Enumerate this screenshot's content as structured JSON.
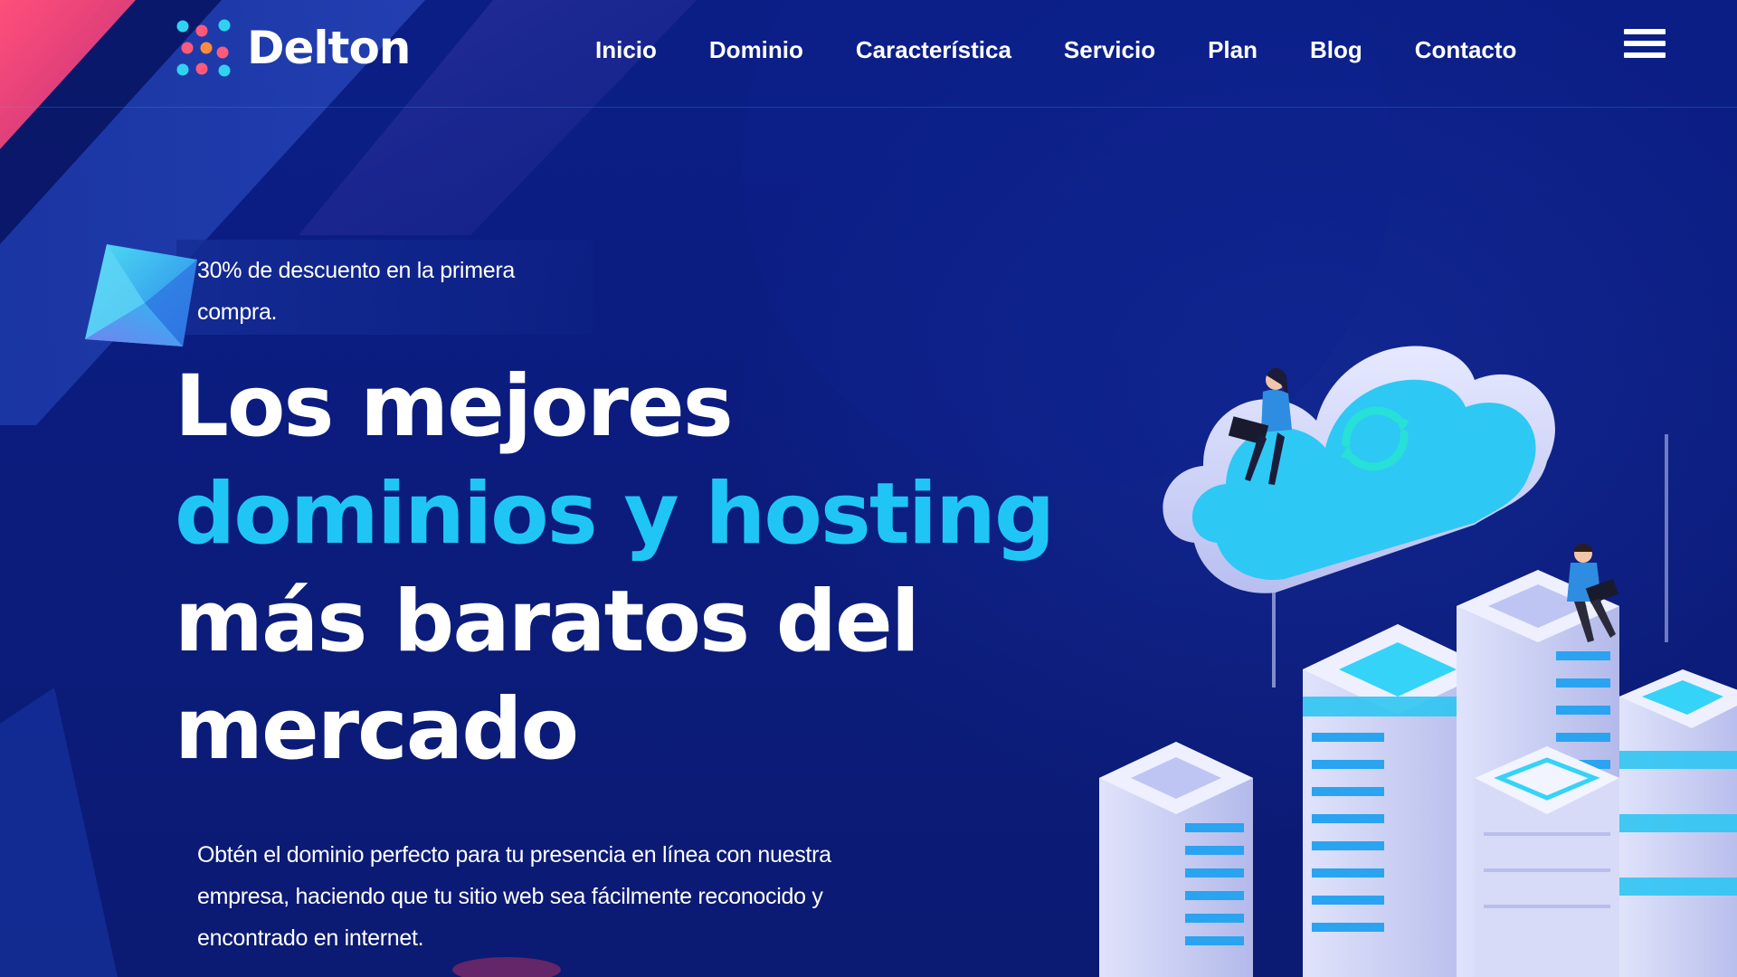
{
  "brand": {
    "name": "Delton"
  },
  "nav": {
    "items": [
      "Inicio",
      "Dominio",
      "Característica",
      "Servicio",
      "Plan",
      "Blog",
      "Contacto"
    ]
  },
  "promo": {
    "text": "30% de descuento en la primera compra."
  },
  "hero": {
    "headline_part1": "Los mejores ",
    "headline_highlight": "dominios y hosting",
    "headline_part2": "más baratos del mercado",
    "description": "Obtén el dominio perfecto para tu presencia en línea con nuestra empresa, haciendo que tu sitio web sea fácilmente reconocido y encontrado en internet."
  },
  "colors": {
    "background": "#0b1e86",
    "accent": "#1fc6f5",
    "text": "#ffffff"
  },
  "icons": {
    "menu": "hamburger-menu-icon",
    "logo": "dots-logo-icon"
  }
}
